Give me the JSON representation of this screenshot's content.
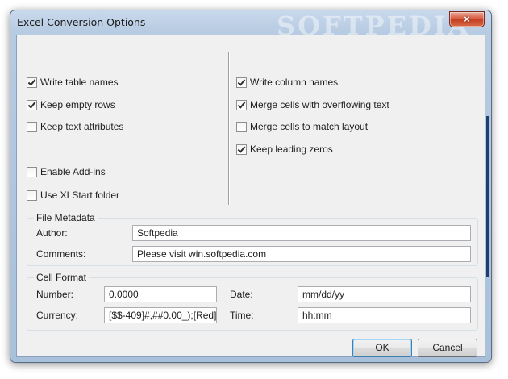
{
  "window": {
    "title": "Excel Conversion Options",
    "close_glyph": "×",
    "watermark": "SOFTPEDIA"
  },
  "options_left": [
    {
      "label": "Write table names",
      "checked": true
    },
    {
      "label": "Keep empty rows",
      "checked": true
    },
    {
      "label": "Keep text attributes",
      "checked": false
    },
    {
      "label": "Enable Add-ins",
      "checked": false
    },
    {
      "label": "Use XLStart folder",
      "checked": false
    }
  ],
  "options_right": [
    {
      "label": "Write column names",
      "checked": true
    },
    {
      "label": "Merge cells with overflowing text",
      "checked": true
    },
    {
      "label": "Merge cells to match layout",
      "checked": false
    },
    {
      "label": "Keep leading zeros",
      "checked": true
    }
  ],
  "file_metadata": {
    "title": "File Metadata",
    "author_label": "Author:",
    "author_value": "Softpedia",
    "comments_label": "Comments:",
    "comments_value": "Please visit win.softpedia.com"
  },
  "cell_format": {
    "title": "Cell Format",
    "number_label": "Number:",
    "number_value": "0.0000",
    "currency_label": "Currency:",
    "currency_value": "[$$-409]#,##0.00_);[Red]",
    "date_label": "Date:",
    "date_value": "mm/dd/yy",
    "time_label": "Time:",
    "time_value": "hh:mm"
  },
  "buttons": {
    "ok": "OK",
    "cancel": "Cancel"
  }
}
